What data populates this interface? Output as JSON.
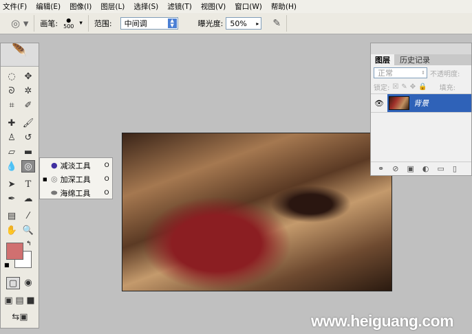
{
  "menu": [
    "文件(F)",
    "编辑(E)",
    "图像(I)",
    "图层(L)",
    "选择(S)",
    "滤镜(T)",
    "视图(V)",
    "窗口(W)",
    "帮助(H)"
  ],
  "options": {
    "brush_label": "画笔:",
    "brush_size": "500",
    "range_label": "范围:",
    "range_value": "中间调",
    "exposure_label": "曝光度:",
    "exposure_value": "50%"
  },
  "flyout": [
    {
      "label": "减淡工具",
      "key": "O"
    },
    {
      "label": "加深工具",
      "key": "O",
      "selected": true
    },
    {
      "label": "海绵工具",
      "key": "O"
    }
  ],
  "panel": {
    "tabs": [
      "图层",
      "历史记录"
    ],
    "blend_mode": "正常",
    "opacity_label": "不透明度:",
    "lock_label": "锁定:",
    "fill_label": "填充:",
    "layer_name": "背景"
  },
  "watermark": "www.heiguang.com",
  "colors": {
    "foreground": "#d07070",
    "background": "#ffffff",
    "selection": "#2f62b8"
  }
}
